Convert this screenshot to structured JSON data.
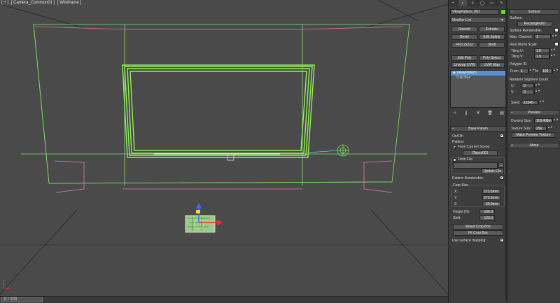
{
  "viewport": {
    "labels": [
      "[ + ]",
      "[ Camera_Common01 ]",
      "[ Wireframe ]"
    ]
  },
  "timeslider": {
    "frame_counter": "0 / 100"
  },
  "command_panel": {
    "tabs": [
      "",
      "",
      "",
      "",
      "",
      ""
    ],
    "object_name": "VRayPattern_001",
    "object_color": "#5bd83a",
    "modifier_list_label": "Modifier List",
    "modifier_buttons": [
      "Smooth",
      "Extrude",
      "Bevel",
      "Edit Spline",
      "FFD 2x2x2",
      "Shell",
      "Edit Poly",
      "Poly Select",
      "Unwrap UVW",
      "UVW Map"
    ],
    "stack_items": [
      {
        "label": "VRayPattern",
        "selected": true
      },
      {
        "label": "Crop Box",
        "selected": false
      }
    ],
    "stack_icons": [
      "pin-icon",
      "show-end-result-icon",
      "make-unique-icon",
      "remove-modifier-icon",
      "configure-modifier-sets-icon"
    ],
    "base_param": {
      "header": "Base Param",
      "onoff_label": "On/Off:",
      "onoff_checked": true,
      "pattern_label": "Pattern:",
      "from_current_scene_label": "From Current Scene",
      "object_button": "Object001",
      "from_file_label": "From File",
      "file_path": "",
      "update_file_button": "Update File",
      "pattern_renderable_label": "Pattern Renderable:",
      "pattern_renderable_checked": true,
      "crop_size_label": "Crop Size",
      "x_label": "X:",
      "x_value": "272.5mm",
      "y_label": "Y:",
      "y_value": "272.5mm",
      "z_label": "Z:",
      "z_value": "60.0mm",
      "height_label": "Height (%)",
      "height_value": "100.0",
      "shift_label": "Shift:",
      "shift_value": "120.0",
      "reset_crop_button": "Reset Crop Box",
      "fit_crop_button": "Fit Crop Box",
      "use_surface_mapping_label": "Use surface mapping:",
      "use_surface_mapping_checked": true
    }
  },
  "side_panel": {
    "surface_header": "Surface",
    "surface_label": "Surface:",
    "surface_button": "Rectangle007",
    "surface_renderable_label": "Surface Renderable:",
    "map_channel_label": "Map. Channel:",
    "map_channel_value": "1",
    "real_world_scale_label": "Real World Scale:",
    "tiling_u_label": "Tiling U:",
    "tiling_u_value": "1.0",
    "tiling_v_label": "Tiling V:",
    "tiling_v_value": "1.0",
    "polygon_id_label": "Polygon ID",
    "from_label": "From:",
    "from_value": "1",
    "to_label": "To:",
    "to_value": "100",
    "random_segment_label": "Random Segment Count",
    "u_label": "U:",
    "u_value": "0",
    "v_label": "V:",
    "v_value": "0",
    "seed_label": "Seed:",
    "seed_value": "12345",
    "preview_header": "Preview",
    "dummy_size_label": "Dummy Size:",
    "dummy_size_value": "118.408m",
    "texture_size_label": "Texture Size:",
    "texture_size_value": "256",
    "make_preview_button": "Make Preview Texture",
    "about_header": "About"
  }
}
